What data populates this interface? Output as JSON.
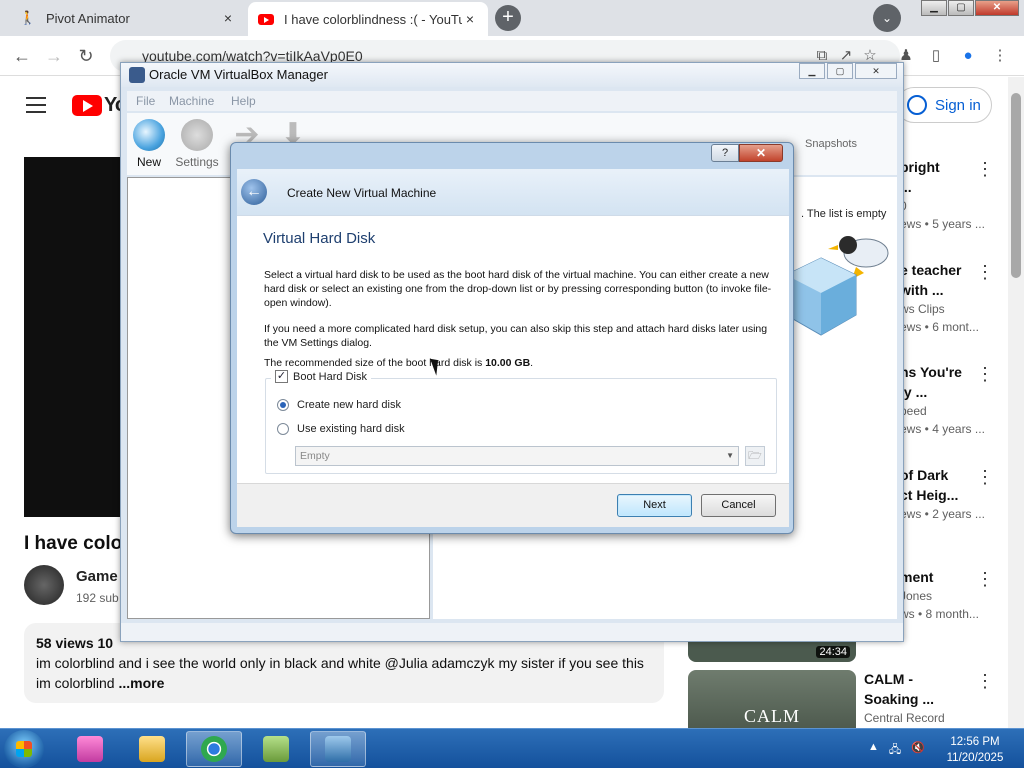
{
  "browser": {
    "tabs": [
      {
        "title": "Pivot Animator",
        "close": "×"
      },
      {
        "title": "I have colorblindness :( - YouTube",
        "close": "×"
      }
    ],
    "new_tab": "+",
    "tab_search": "⌄",
    "url": "youtube.com/watch?v=tiIkAaVp0E0"
  },
  "youtube": {
    "logo_text": "Yo",
    "sign_in": "Sign in",
    "video_title": "I have colo",
    "channel_name": "Game",
    "channel_subs": "192 sub",
    "description": {
      "views": "58 views",
      "date": "10",
      "text": "im colorblind and i see the world only in black and white @Julia   adamczyk my sister if you see this im colorblind",
      "more": "...more"
    },
    "related": [
      {
        "title1": "bright",
        "title2": "...",
        "channel": "0",
        "meta": "ews • 5 years ..."
      },
      {
        "title1": "e teacher",
        "title2": "with ...",
        "channel": "ws Clips",
        "meta": "ews • 6 mont..."
      },
      {
        "title1": "ns You're",
        "title2": "ly ...",
        "channel": "peed",
        "meta": "ews • 4 years ..."
      },
      {
        "title1": "of Dark",
        "title2": "ct Heig...",
        "channel": "",
        "meta": "ews • 2 years ..."
      },
      {
        "title1": "ment",
        "title2": "",
        "channel": "Jones",
        "meta": "ws • 8 month..."
      },
      {
        "title1": "CALM -",
        "title2": "Soaking ...",
        "channel": "Central Record",
        "meta": ""
      }
    ],
    "thumb_duration": "24:34",
    "calm_label": "CALM"
  },
  "vbox": {
    "title": "Oracle VM VirtualBox Manager",
    "menu": [
      "File",
      "Machine",
      "Help"
    ],
    "toolbar": {
      "new": "New",
      "settings": "Settings"
    },
    "snapshots": "Snapshots",
    "empty_notice": ". The list is empty",
    "window_buttons": {
      "min": "▁",
      "max": "▢",
      "close": "✕"
    }
  },
  "wizard": {
    "help": "?",
    "close": "✕",
    "back_arrow": "←",
    "heading": "Create New Virtual Machine",
    "page_title": "Virtual Hard Disk",
    "para1": "Select a virtual hard disk to be used as the boot hard disk of the virtual machine. You can either create a new hard disk or select an existing one from the drop-down list or by pressing corresponding button (to invoke file-open window).",
    "para2": "If you need a more complicated hard disk setup, you can also skip this step and attach hard disks later using the VM Settings dialog.",
    "recommended_prefix": "The recommended size of the boot hard disk is ",
    "recommended_size": "10.00 GB",
    "recommended_suffix": ".",
    "boot_hard_disk": "Boot Hard Disk",
    "boot_checked": "✓",
    "create_new": "Create new hard disk",
    "use_existing": "Use existing hard disk",
    "combo_value": "Empty",
    "combo_arrow": "▼",
    "browse_icon": "folder-icon",
    "next": "Next",
    "cancel": "Cancel"
  },
  "taskbar": {
    "time": "12:56 PM",
    "date": "11/20/2025"
  },
  "colors": {
    "youtube_red": "#ff0000",
    "link_blue": "#065fd4",
    "wizard_frame": "#bcd3ea",
    "taskbar": "#1f63ad"
  }
}
